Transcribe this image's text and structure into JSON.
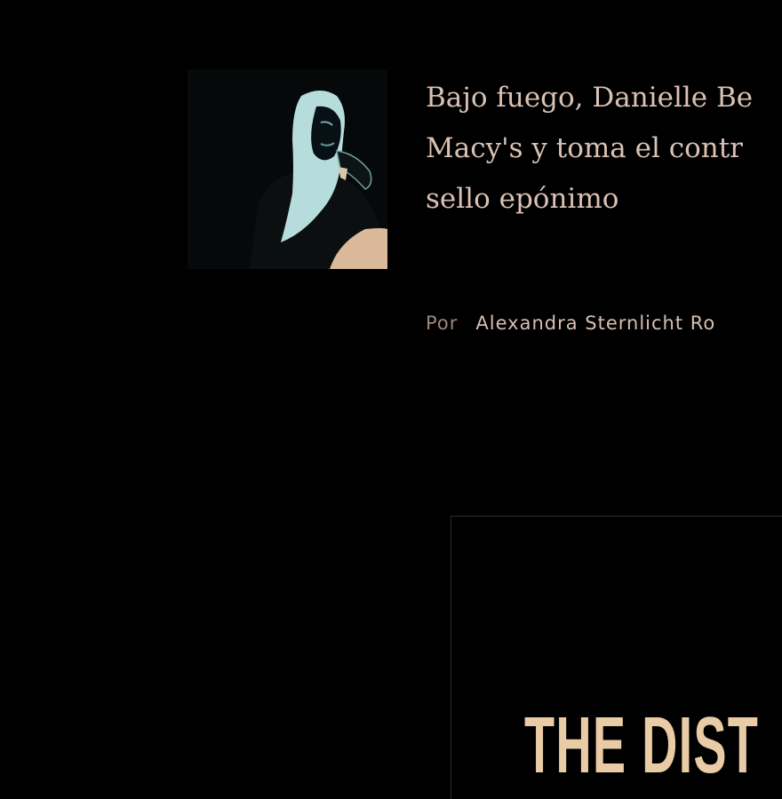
{
  "article": {
    "headline_lines": [
      "Bajo fuego, Danielle Be",
      "Macy's y toma el contr",
      "sello epónimo"
    ],
    "byline_prefix": "Por",
    "author": "Alexandra Sternlicht Ro"
  },
  "promo": {
    "title": "THE DIST"
  },
  "colors": {
    "background": "#000000",
    "headline": "#d9c2b3",
    "promo_title": "#e9cca6"
  }
}
